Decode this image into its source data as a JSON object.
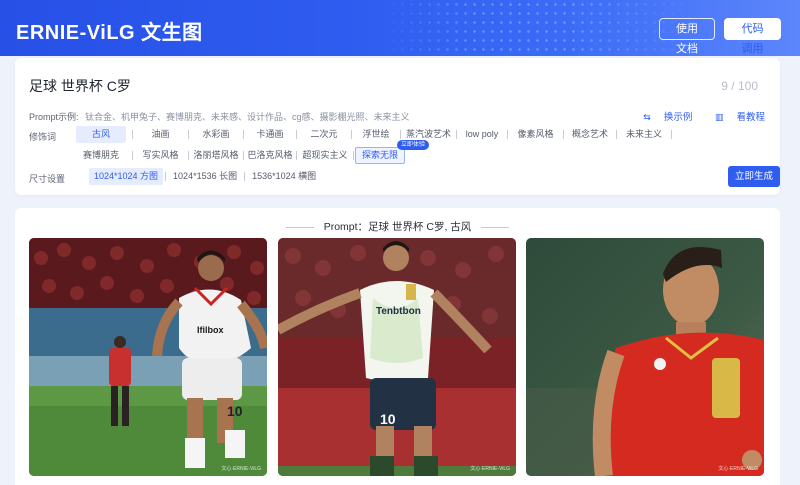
{
  "header": {
    "brand": "ERNIE-ViLG 文生图",
    "docs_button": "使用文档",
    "api_button": "代码调用"
  },
  "prompt": {
    "value": "足球 世界杯 C罗",
    "counter": "9 / 100",
    "examples_label": "Prompt示例:",
    "examples": "钛合金、机甲兔子、赛博朋克、未来感、设计作品、cg感、摄影棚光照、未来主义",
    "swap_link": "换示例",
    "tutorial_link": "看教程"
  },
  "modifiers": {
    "label": "修饰词",
    "row1": [
      "古风",
      "油画",
      "水彩画",
      "卡通画",
      "二次元",
      "浮世绘",
      "蒸汽波艺术",
      "low poly",
      "像素风格",
      "概念艺术",
      "未来主义"
    ],
    "row2": [
      "赛博朋克",
      "写实风格",
      "洛丽塔风格",
      "巴洛克风格",
      "超现实主义",
      "探索无限"
    ],
    "selected": "古风",
    "badge": "立即体验"
  },
  "size": {
    "label": "尺寸设置",
    "options": [
      "1024*1024 方图",
      "1024*1536 长图",
      "1536*1024 横图"
    ],
    "selected": "1024*1024 方图"
  },
  "generate_button": "立即生成",
  "result": {
    "title": "Prompt：足球 世界杯 C罗, 古风",
    "images": [
      {
        "subject": "player-running-white-kit",
        "jersey_text": "Ifilbox",
        "watermark": "文心·ERNIE-ViLG"
      },
      {
        "subject": "player-arms-wide-white-kit",
        "jersey_text": "Tenbtbon",
        "watermark": "文心·ERNIE-ViLG"
      },
      {
        "subject": "player-portrait-red-kit",
        "jersey_text": "",
        "watermark": "文心·ERNIE-ViLG"
      }
    ]
  },
  "colors": {
    "accent": "#2f5df0",
    "header_start": "#2750e6",
    "header_end": "#5c86fb",
    "page_bg": "#eef2fb"
  }
}
